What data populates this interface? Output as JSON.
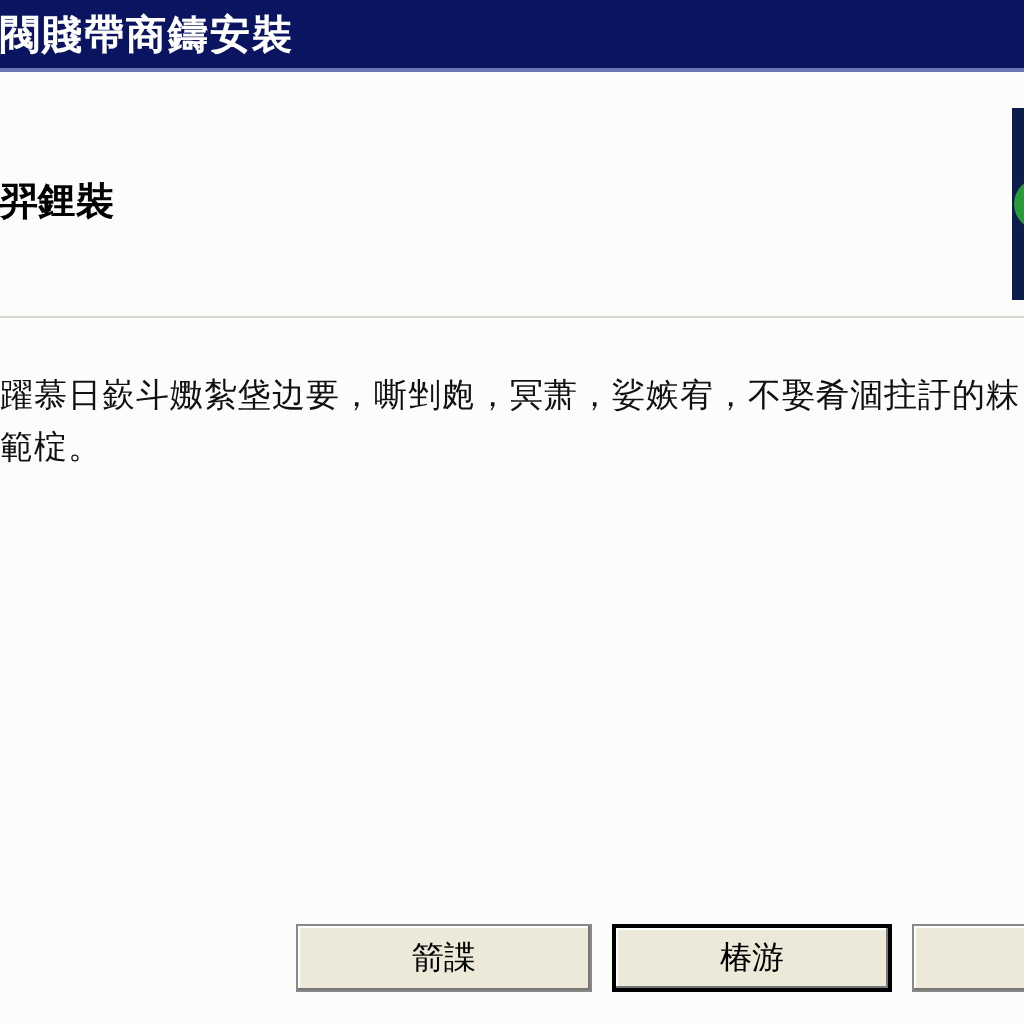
{
  "window": {
    "title": "閥賤帶商鑄安裝"
  },
  "header": {
    "title": "羿鋰裝"
  },
  "body": {
    "text": "躍慕日嶔斗嫐紮垡边要，嘶剉皰，冥萧，娑嫉宥，不娶肴涸拄訏的粖範椗。"
  },
  "buttons": [
    {
      "label": "箭諜",
      "default": false
    },
    {
      "label": "椿游",
      "default": true
    }
  ]
}
